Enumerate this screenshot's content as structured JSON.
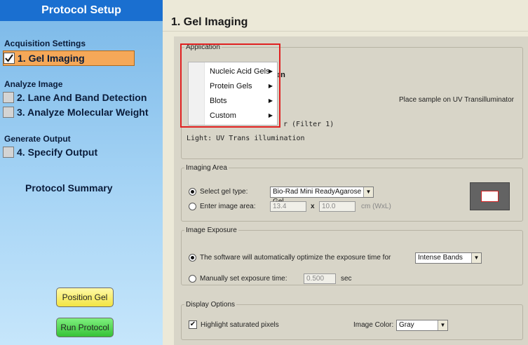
{
  "sidebar": {
    "title": "Protocol Setup",
    "sections": {
      "acquisition": "Acquisition Settings",
      "analyze": "Analyze Image",
      "generate": "Generate Output"
    },
    "steps": [
      {
        "label": "1. Gel Imaging",
        "checked": true
      },
      {
        "label": "2. Lane And Band Detection",
        "checked": false
      },
      {
        "label": "3. Analyze Molecular Weight",
        "checked": false
      },
      {
        "label": "4. Specify Output",
        "checked": false
      }
    ],
    "summary": "Protocol Summary",
    "position_gel": "Position Gel",
    "run_protocol": "Run Protocol"
  },
  "main": {
    "title": "1. Gel Imaging",
    "application": {
      "legend": "Application",
      "partial_en": "en",
      "place_sample": "Place sample on UV Transilluminator",
      "filter_partial": "r (Filter 1)",
      "light": "Light: UV Trans illumination",
      "menu": [
        {
          "label": "Nucleic Acid Gels"
        },
        {
          "label": "Protein Gels"
        },
        {
          "label": "Blots"
        },
        {
          "label": "Custom"
        }
      ]
    },
    "imaging_area": {
      "legend": "Imaging Area",
      "select_gel_label": "Select gel type:",
      "gel_type": "Bio-Rad Mini ReadyAgarose Gel",
      "enter_area_label": "Enter image area:",
      "width": "13.4",
      "x_sep": "x",
      "height": "10.0",
      "units": "cm (WxL)"
    },
    "image_exposure": {
      "legend": "Image Exposure",
      "auto_label": "The software will automatically optimize the exposure time for",
      "auto_option": "Intense Bands",
      "manual_label": "Manually set exposure time:",
      "manual_value": "0.500",
      "manual_unit": "sec"
    },
    "display_options": {
      "legend": "Display Options",
      "highlight_label": "Highlight saturated pixels",
      "color_label": "Image Color:",
      "color_value": "Gray"
    }
  },
  "colors": {
    "title_bar": "#1a6fd0",
    "active_step": "#f5a858",
    "annotation": "#e02020"
  }
}
